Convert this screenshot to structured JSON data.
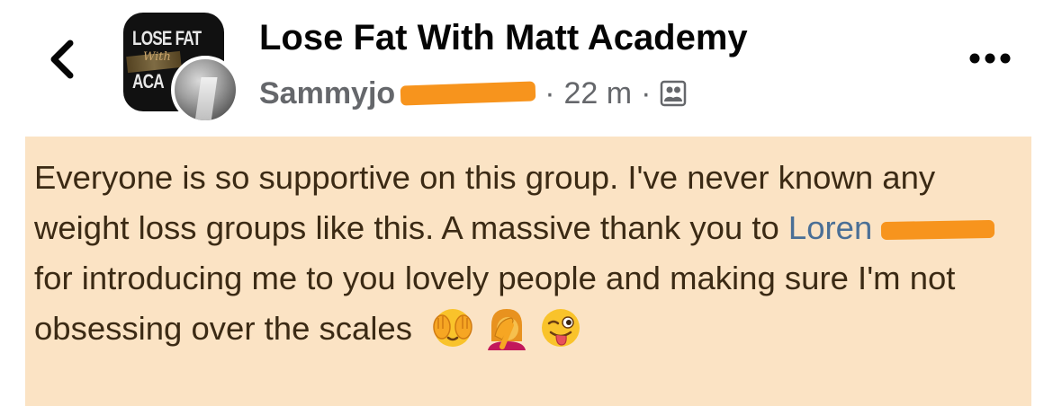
{
  "header": {
    "back_icon": "chevron-left-icon",
    "group_name": "Lose Fat With Matt Academy",
    "group_logo": {
      "line1": "LOSE FAT",
      "line2": "With",
      "line3": "ACA"
    },
    "author_name": "Sammyjo",
    "timestamp": "22 m",
    "separator": "·",
    "audience_icon": "group-members-icon",
    "more_icon": "more-horizontal-icon"
  },
  "post": {
    "text_before_mention": "Everyone is so supportive on this group. I've never known any weight loss groups like this. A massive thank you to ",
    "mention_name": "Loren",
    "text_after_mention": "for introducing me to you lovely people and making sure I'm not obsessing over the scales",
    "background_color": "#fbe3c4",
    "emojis": [
      "face-with-hand-over-eyes-emoji",
      "person-facepalming-emoji",
      "winking-face-with-tongue-emoji"
    ]
  },
  "colors": {
    "redaction": "#f7941d",
    "mention": "#4a6f96",
    "meta": "#65676b"
  }
}
